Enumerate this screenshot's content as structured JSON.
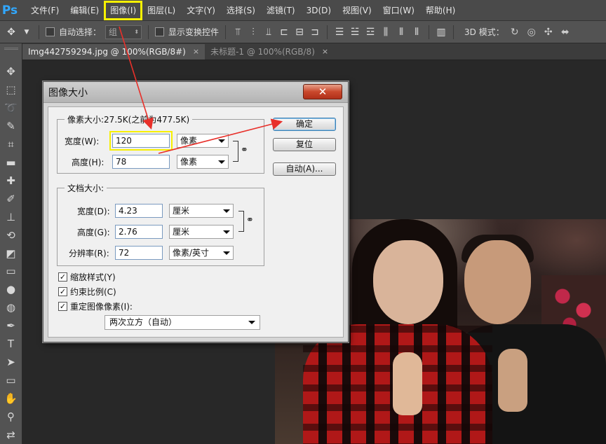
{
  "app": {
    "logo": "Ps",
    "menu": [
      "文件(F)",
      "编辑(E)",
      "图像(I)",
      "图层(L)",
      "文字(Y)",
      "选择(S)",
      "滤镜(T)",
      "3D(D)",
      "视图(V)",
      "窗口(W)",
      "帮助(H)"
    ],
    "highlighted_menu_index": 2
  },
  "options_bar": {
    "auto_select_label": "自动选择：",
    "auto_select_value": "组",
    "show_transform_label": "显示变换控件",
    "mode_label": "3D 模式："
  },
  "tabs": [
    {
      "label": "Img442759294.jpg @ 100%(RGB/8#)",
      "close": "×"
    },
    {
      "label": "未标题-1 @ 100%(RGB/8)",
      "close": "×"
    }
  ],
  "dialog": {
    "title": "图像大小",
    "close": "✕",
    "pixel_group": {
      "title": "像素大小:27.5K(之前为477.5K)",
      "width_label": "宽度(W):",
      "width_value": "120",
      "width_unit": "像素",
      "height_label": "高度(H):",
      "height_value": "78",
      "height_unit": "像素"
    },
    "doc_group": {
      "title": "文档大小:",
      "width_label": "宽度(D):",
      "width_value": "4.23",
      "width_unit": "厘米",
      "height_label": "高度(G):",
      "height_value": "2.76",
      "height_unit": "厘米",
      "resolution_label": "分辨率(R):",
      "resolution_value": "72",
      "resolution_unit": "像素/英寸"
    },
    "checkboxes": [
      {
        "label": "缩放样式(Y)",
        "checked": true
      },
      {
        "label": "约束比例(C)",
        "checked": true
      },
      {
        "label": "重定图像像素(I):",
        "checked": true
      }
    ],
    "check_mark": "✓",
    "resample_value": "两次立方（自动）",
    "buttons": {
      "ok": "确定",
      "reset": "复位",
      "auto": "自动(A)..."
    }
  },
  "colors": {
    "annotation_red": "#e8302a",
    "highlight_yellow": "#f7f000"
  }
}
